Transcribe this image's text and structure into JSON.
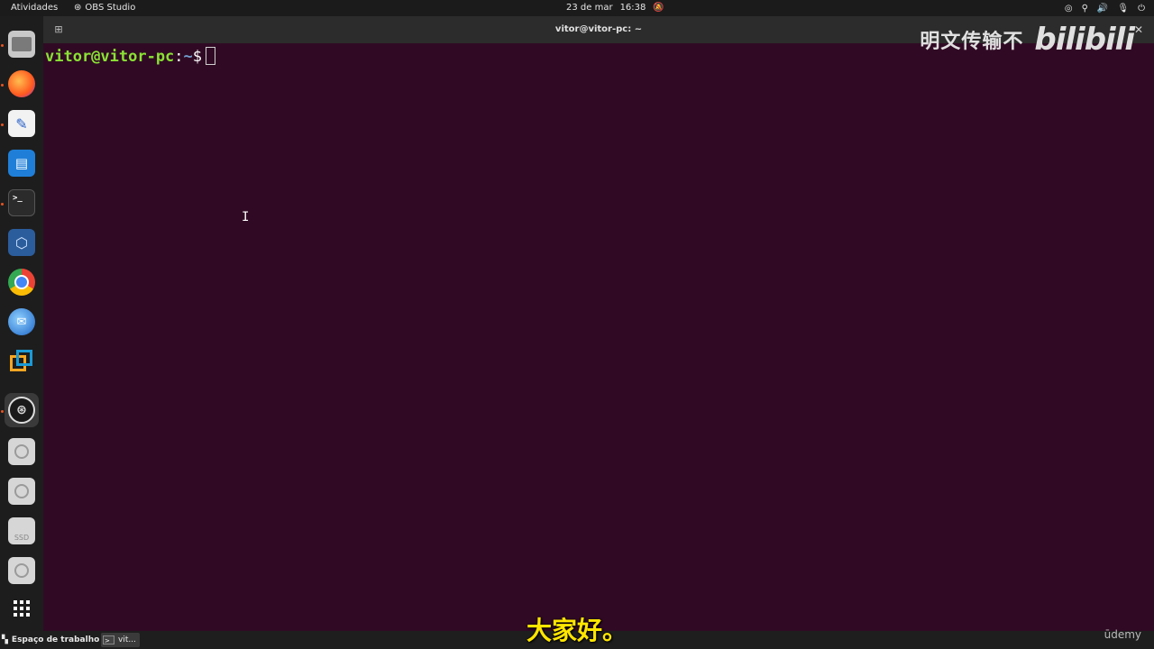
{
  "topbar": {
    "activities": "Atividades",
    "app_name": "OBS Studio",
    "date": "23 de mar",
    "time": "16:38"
  },
  "dock": {
    "items": [
      {
        "name": "files",
        "icon": "folder-icon",
        "running": true
      },
      {
        "name": "firefox",
        "icon": "firefox-icon",
        "running": true
      },
      {
        "name": "text-editor",
        "icon": "text-editor-icon",
        "running": true
      },
      {
        "name": "libreoffice-writer",
        "icon": "document-icon",
        "running": false
      },
      {
        "name": "terminal",
        "icon": "terminal-icon",
        "running": true
      },
      {
        "name": "virtualbox",
        "icon": "virtualbox-icon",
        "running": false
      },
      {
        "name": "chrome",
        "icon": "chrome-icon",
        "running": false
      },
      {
        "name": "thunderbird",
        "icon": "mail-icon",
        "running": false
      },
      {
        "name": "vmware",
        "icon": "vmware-icon",
        "running": false
      },
      {
        "name": "obs",
        "icon": "obs-icon",
        "running": true
      },
      {
        "name": "drive-1",
        "icon": "disk-icon",
        "running": false
      },
      {
        "name": "drive-2",
        "icon": "disk-icon",
        "running": false
      },
      {
        "name": "ssd",
        "icon": "ssd-icon",
        "label": "SSD",
        "running": false
      },
      {
        "name": "drive-3",
        "icon": "disk-icon",
        "running": false
      },
      {
        "name": "show-apps",
        "icon": "grid-icon",
        "running": false
      }
    ]
  },
  "terminal": {
    "title": "vitor@vitor-pc: ~",
    "prompt_user": "vitor@vitor-pc",
    "prompt_colon": ":",
    "prompt_path": "~",
    "prompt_symbol": "$"
  },
  "watermark": {
    "text": "明文传输不",
    "logo": "bilibili"
  },
  "taskbar": {
    "workspace": "Espaço de trabalho 1",
    "window_label": "vit..."
  },
  "subtitle": "大家好。",
  "udemy": "ūdemy",
  "colors": {
    "terminal_bg": "#300a24",
    "prompt_user": "#8ae234",
    "prompt_path": "#729fcf",
    "subtitle": "#ffe600",
    "running_dot": "#e95420"
  }
}
